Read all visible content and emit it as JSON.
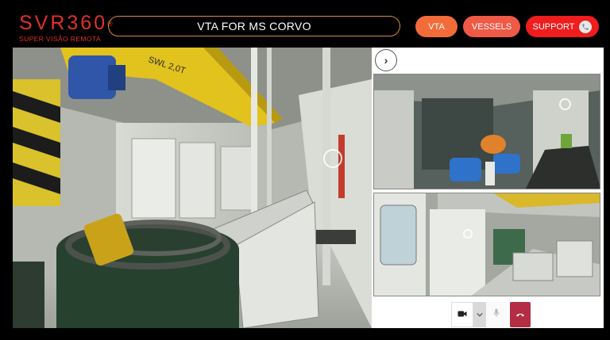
{
  "header": {
    "logo_main": "SVR360",
    "logo_reg": "®",
    "logo_sub": "SUPER VISÃO REMOTA",
    "session_title": "VTA FOR MS CORVO"
  },
  "nav": {
    "vta_label": "VTA",
    "vessels_label": "VESSELS",
    "support_label": "SUPPORT"
  },
  "scene": {
    "crane_label": "SWL 2,0T"
  },
  "colors": {
    "brand_red": "#e0312b",
    "vta_orange": "#f26b38",
    "vessels_coral": "#ee5a46",
    "support_red": "#ef1d1d",
    "title_border": "#d98a3a",
    "hangup": "#b42d45"
  },
  "icons": {
    "collapse": "chevron-right-icon",
    "support": "phone-icon",
    "camera": "video-camera-icon",
    "camera_options": "chevron-down-icon",
    "mic": "microphone-icon",
    "hangup": "hang-up-icon"
  }
}
